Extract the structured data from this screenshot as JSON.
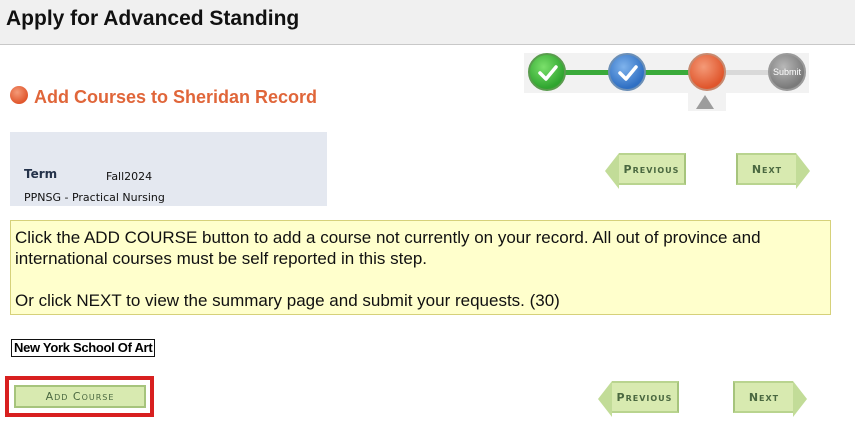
{
  "header": {
    "title": "Apply for Advanced Standing"
  },
  "progress": {
    "steps": [
      {
        "state": "complete",
        "icon": "checkmark-icon"
      },
      {
        "state": "complete",
        "icon": "checkmark-icon"
      },
      {
        "state": "current",
        "icon": ""
      },
      {
        "state": "upcoming",
        "label": "Submit"
      }
    ],
    "colors": {
      "complete_1": "#2fa52f",
      "complete_2": "#2f6fc3",
      "current": "#e0562c",
      "upcoming": "#7a7a7a"
    }
  },
  "section": {
    "title": "Add Courses to Sheridan Record",
    "title_color": "#e0663a"
  },
  "info": {
    "term_label": "Term",
    "term_value": "Fall2024",
    "program": "PPNSG - Practical Nursing"
  },
  "nav": {
    "previous_label": "Previous",
    "next_label": "Next"
  },
  "message": {
    "line1": "Click the ADD COURSE button to add a course not currently on your record. All out of province and international courses must be self reported in this step.",
    "line2": "Or click NEXT to view the summary page and submit your requests. (30)"
  },
  "school": {
    "name": "New York School Of Art"
  },
  "actions": {
    "add_course_label": "Add Course"
  }
}
